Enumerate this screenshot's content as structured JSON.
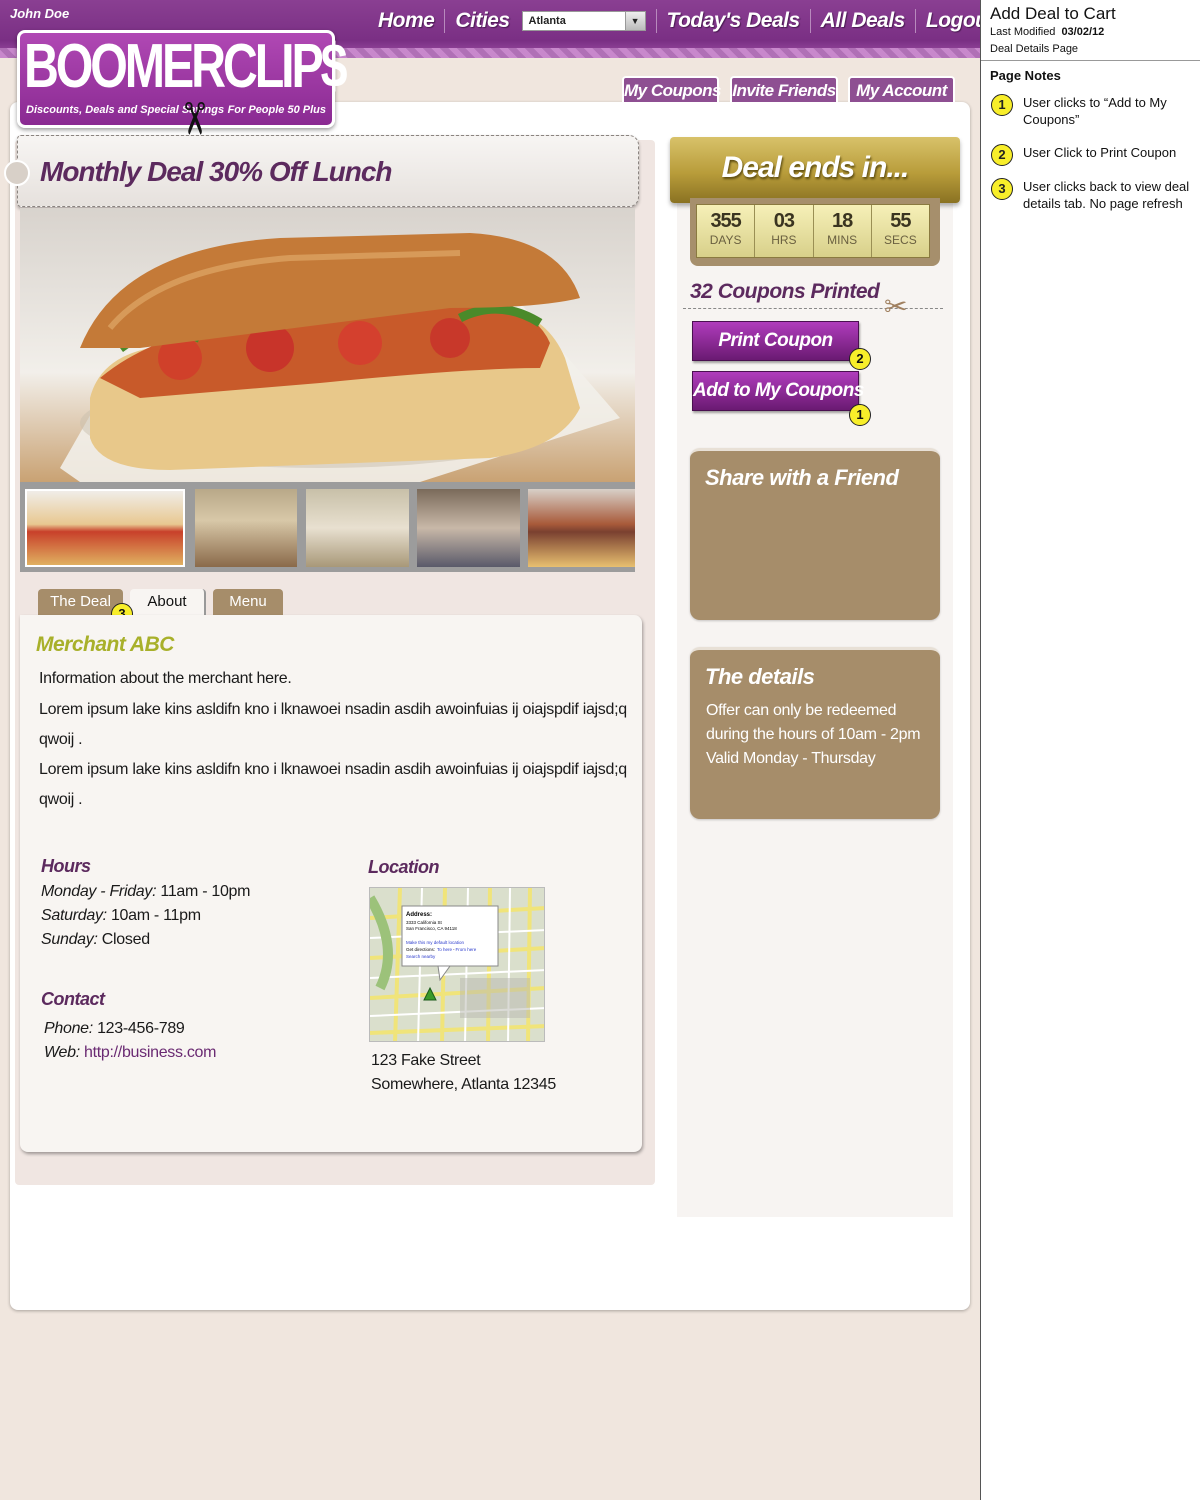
{
  "header": {
    "user_name": "John Doe",
    "nav": {
      "home": "Home",
      "cities": "Cities",
      "todays_deals": "Today's Deals",
      "all_deals": "All Deals",
      "logout": "Logout"
    },
    "city_select": {
      "value": "Atlanta"
    },
    "logo": {
      "brand": "BOOMERCLIP$",
      "tagline_left": "Discounts, Deals and Special Savings",
      "tagline_right": "For People 50 Plus"
    },
    "account_tabs": {
      "my_coupons": "My Coupons",
      "invite_friends": "Invite Friends",
      "my_account": "My Account"
    }
  },
  "deal": {
    "title": "Monthly Deal 30% Off Lunch",
    "tabs": {
      "the_deal": "The Deal",
      "about": "About",
      "menu": "Menu"
    },
    "merchant": {
      "name": "Merchant ABC",
      "intro": "Information about the merchant here.",
      "para1_line1": "Lorem ipsum lake kins asldifn kno i lknawoei nsadin asdih awoinfuias ij oiajspdif iajsd;q",
      "para1_line2": "qwoij .",
      "para2_line1": "Lorem ipsum lake kins asldifn kno i lknawoei nsadin asdih awoinfuias ij oiajspdif iajsd;q",
      "para2_line2": "qwoij ."
    },
    "hours": {
      "heading": "Hours",
      "rows": [
        {
          "day": "Monday - Friday:",
          "time": "11am - 10pm"
        },
        {
          "day": "Saturday:",
          "time": "10am - 11pm"
        },
        {
          "day": "Sunday:",
          "time": "Closed"
        }
      ]
    },
    "contact": {
      "heading": "Contact",
      "phone_label": "Phone:",
      "phone": "123-456-789",
      "web_label": "Web:",
      "web": "http://business.com"
    },
    "location": {
      "heading": "Location",
      "address_line1": "123 Fake Street",
      "address_line2": "Somewhere, Atlanta 12345",
      "map_popup": {
        "title": "Address:",
        "line1": "3333 California St",
        "line2": "San Francisco, CA 94118",
        "default_link": "Make this my default location",
        "directions_label": "Get directions:",
        "to_here": "To here",
        "sep": "-",
        "from_here": "From here",
        "search_nearby": "Search nearby"
      }
    }
  },
  "sidebar": {
    "deal_ends_label": "Deal ends in...",
    "countdown": {
      "days": "355",
      "hrs": "03",
      "mins": "18",
      "secs": "55",
      "days_unit": "DAYS",
      "hrs_unit": "HRS",
      "mins_unit": "MINS",
      "secs_unit": "SECS"
    },
    "coupons_printed": "32 Coupons Printed",
    "print_coupon": "Print Coupon",
    "add_to_my_coupons": "Add to My Coupons",
    "share_heading": "Share with a Friend",
    "details": {
      "heading": "The details",
      "line1": "Offer can only be redeemed",
      "line2": "during the hours of 10am - 2pm",
      "line3": "Valid Monday - Thursday"
    }
  },
  "markers": {
    "m1": "1",
    "m2": "2",
    "m3": "3"
  },
  "notes": {
    "title": "Add Deal to Cart",
    "last_modified_label": "Last Modified",
    "last_modified": "03/02/12",
    "page_name": "Deal Details Page",
    "heading": "Page Notes",
    "items": [
      {
        "num": "1",
        "text": "User clicks to “Add to My Coupons”"
      },
      {
        "num": "2",
        "text": "User Click to Print Coupon"
      },
      {
        "num": "3",
        "text": "User clicks back to view deal details tab. No page refresh"
      }
    ]
  },
  "colors": {
    "brand_purple": "#7a2f84",
    "accent_olive": "#a8b02a",
    "tan": "#a68d6a",
    "gold": "#b89c3a",
    "marker_yellow": "#f8ee2a"
  }
}
